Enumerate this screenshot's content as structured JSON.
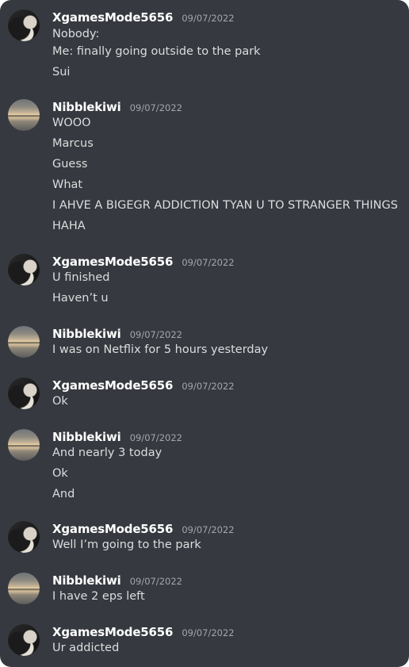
{
  "messages": [
    {
      "author": "XgamesMode5656",
      "time": "09/07/2022",
      "avatar": "dog-avatar",
      "lines": [
        "Nobody:",
        "Me: finally going outside to the park",
        "Sui"
      ]
    },
    {
      "author": "Nibblekiwi",
      "time": "09/07/2022",
      "avatar": "sunset-avatar",
      "lines": [
        "WOOO",
        "Marcus",
        "Guess",
        "What",
        "I AHVE A BIGEGR ADDICTION TYAN U TO STRANGER THINGS",
        "HAHA"
      ]
    },
    {
      "author": "XgamesMode5656",
      "time": "09/07/2022",
      "avatar": "dog-avatar",
      "lines": [
        "U finished",
        "Haven’t u"
      ]
    },
    {
      "author": "Nibblekiwi",
      "time": "09/07/2022",
      "avatar": "sunset-avatar",
      "lines": [
        "I was on Netflix for 5 hours yesterday"
      ]
    },
    {
      "author": "XgamesMode5656",
      "time": "09/07/2022",
      "avatar": "dog-avatar",
      "lines": [
        "Ok"
      ]
    },
    {
      "author": "Nibblekiwi",
      "time": "09/07/2022",
      "avatar": "sunset-avatar",
      "lines": [
        "And nearly 3 today",
        "Ok",
        "And"
      ]
    },
    {
      "author": "XgamesMode5656",
      "time": "09/07/2022",
      "avatar": "dog-avatar",
      "lines": [
        "Well I’m going to the park"
      ]
    },
    {
      "author": "Nibblekiwi",
      "time": "09/07/2022",
      "avatar": "sunset-avatar",
      "lines": [
        "I have 2 eps left"
      ]
    },
    {
      "author": "XgamesMode5656",
      "time": "09/07/2022",
      "avatar": "dog-avatar",
      "lines": [
        "Ur addicted"
      ]
    }
  ],
  "colors": {
    "background": "#36393f",
    "username": "#ffffff",
    "timestamp": "#a3a6aa",
    "text": "#dcddde"
  }
}
